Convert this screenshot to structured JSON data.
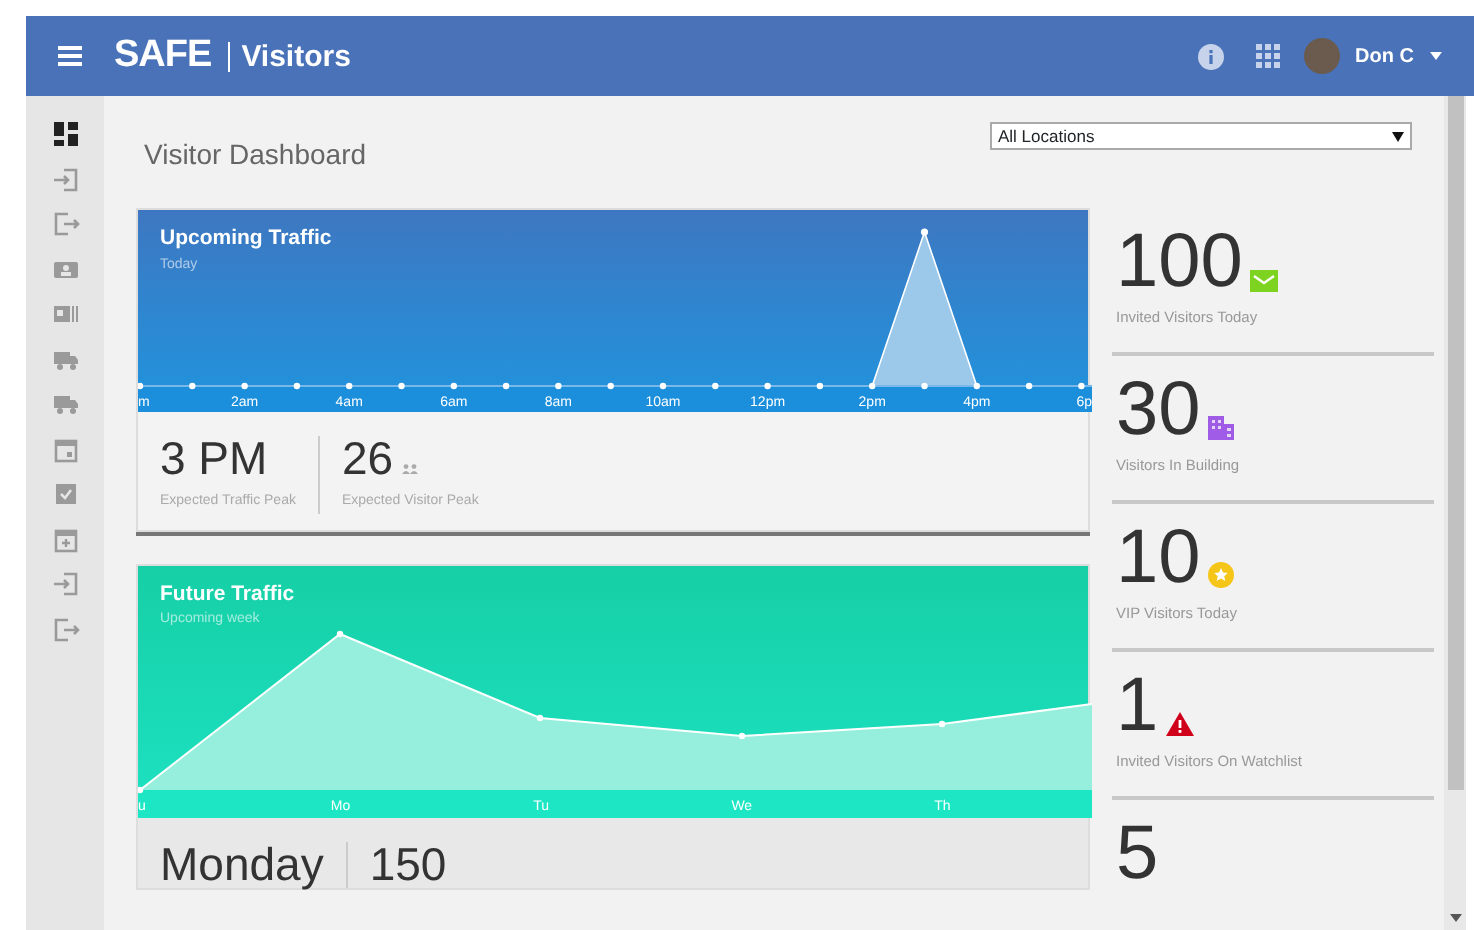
{
  "header": {
    "brand": "SAFE",
    "section": "Visitors",
    "user": "Don C"
  },
  "sidebar": {
    "items": [
      {
        "kind": "dashboard",
        "selected": true
      },
      {
        "kind": "sign-in",
        "selected": false
      },
      {
        "kind": "sign-out",
        "selected": false
      },
      {
        "kind": "id-card",
        "selected": false
      },
      {
        "kind": "badge",
        "selected": false
      },
      {
        "kind": "truck",
        "selected": false
      },
      {
        "kind": "truck",
        "selected": false
      },
      {
        "kind": "calendar",
        "selected": false
      },
      {
        "kind": "check",
        "selected": false
      },
      {
        "kind": "calendar-plus",
        "selected": false
      },
      {
        "kind": "sign-in",
        "selected": false
      },
      {
        "kind": "sign-out",
        "selected": false
      }
    ]
  },
  "page_title": "Visitor Dashboard",
  "location_filter": {
    "value": "All Locations"
  },
  "upcoming_traffic": {
    "title": "Upcoming Traffic",
    "subtitle": "Today",
    "x_labels": [
      "m",
      "2am",
      "4am",
      "6am",
      "8am",
      "10am",
      "12pm",
      "2pm",
      "4pm",
      "6p"
    ],
    "stats": [
      {
        "value": "3 PM",
        "label": "Expected Traffic Peak",
        "icon": false
      },
      {
        "value": "26",
        "label": "Expected Visitor Peak",
        "icon": true
      }
    ]
  },
  "future_traffic": {
    "title": "Future Traffic",
    "subtitle": "Upcoming week",
    "x_labels": [
      "u",
      "Mo",
      "Tu",
      "We",
      "Th"
    ],
    "stats": [
      {
        "value": "Monday"
      },
      {
        "value": "150"
      }
    ]
  },
  "summary": [
    {
      "value": "100",
      "label": "Invited Visitors Today",
      "kind": "envelope",
      "color": "#7ed321"
    },
    {
      "value": "30",
      "label": "Visitors In Building",
      "kind": "building",
      "color": "#a05ce6"
    },
    {
      "value": "10",
      "label": "VIP Visitors Today",
      "kind": "star",
      "color": "#f5c518"
    },
    {
      "value": "1",
      "label": "Invited Visitors On Watchlist",
      "kind": "warning",
      "color": "#d0021b"
    },
    {
      "value": "5",
      "kind": "none"
    }
  ]
}
